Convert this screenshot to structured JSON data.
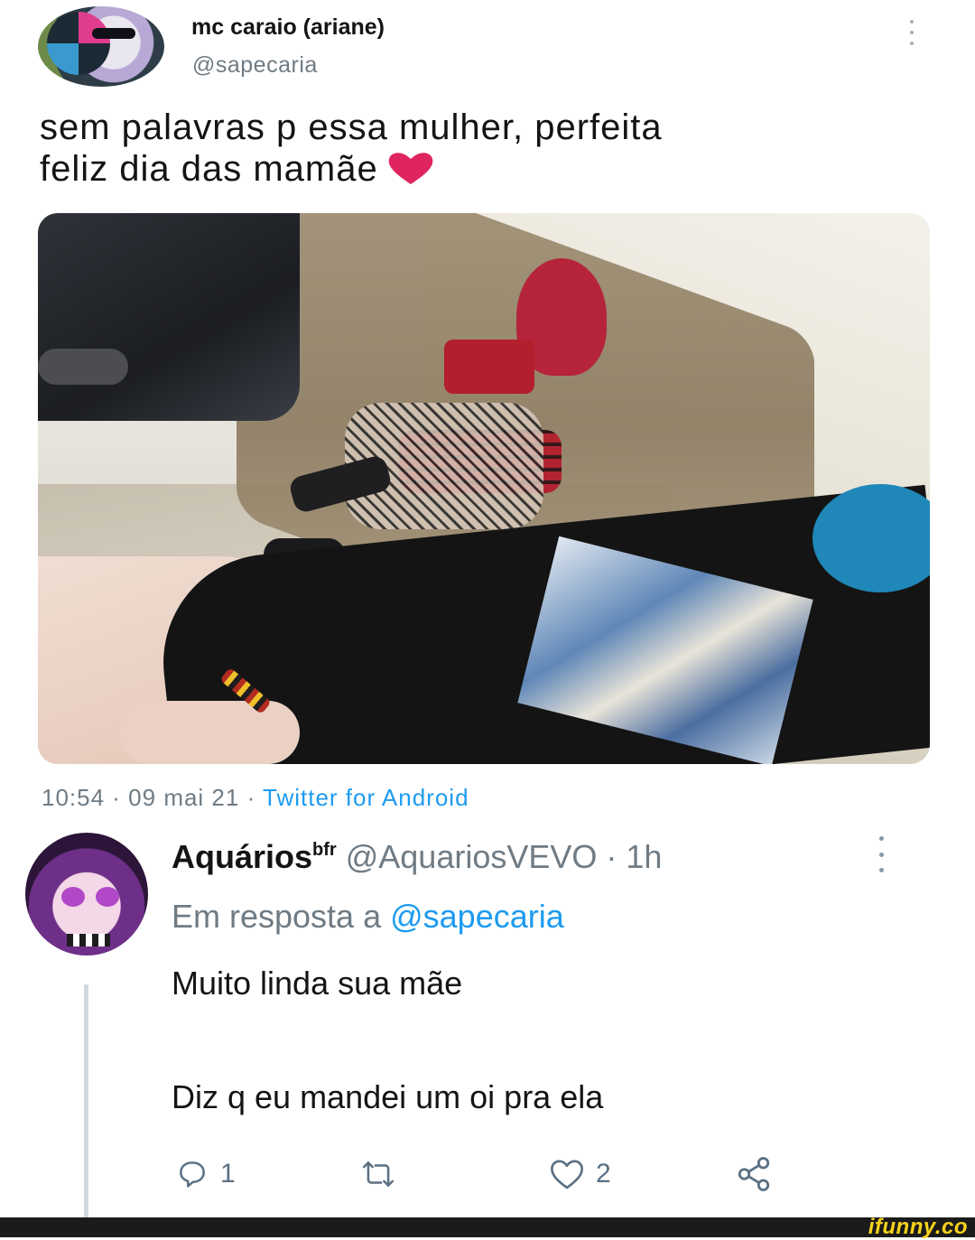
{
  "tweet": {
    "author_name": "mc caraio (ariane)",
    "author_handle": "@sapecaria",
    "text_line1": "sem palavras p essa mulher, perfeita",
    "text_line2": "feliz dia das mamãe",
    "timestamp": "10:54 · 09 mai 21 · ",
    "source": "Twitter for Android",
    "heart_color": "#e0245e"
  },
  "reply": {
    "author_name": "Aquários",
    "author_name_sup": "bfr",
    "author_handle": "@AquariosVEVO",
    "time": " · 1h",
    "reply_to_prefix": "Em resposta a ",
    "reply_to_handle": "@sapecaria",
    "body_line1": "Muito linda sua mãe",
    "body_line2": "Diz q eu mandei um oi pra ela",
    "reply_count": "1",
    "like_count": "2"
  },
  "icons": [
    "more-vertical-icon",
    "reply-icon",
    "retweet-icon",
    "like-icon",
    "share-icon",
    "heart-emoji"
  ],
  "colors": {
    "link_blue": "#1d9bf0",
    "secondary_text": "#6f7b84",
    "action_grey": "#5b7083",
    "watermark_yellow": "#f6d21a"
  },
  "watermark": "ifunny.co"
}
